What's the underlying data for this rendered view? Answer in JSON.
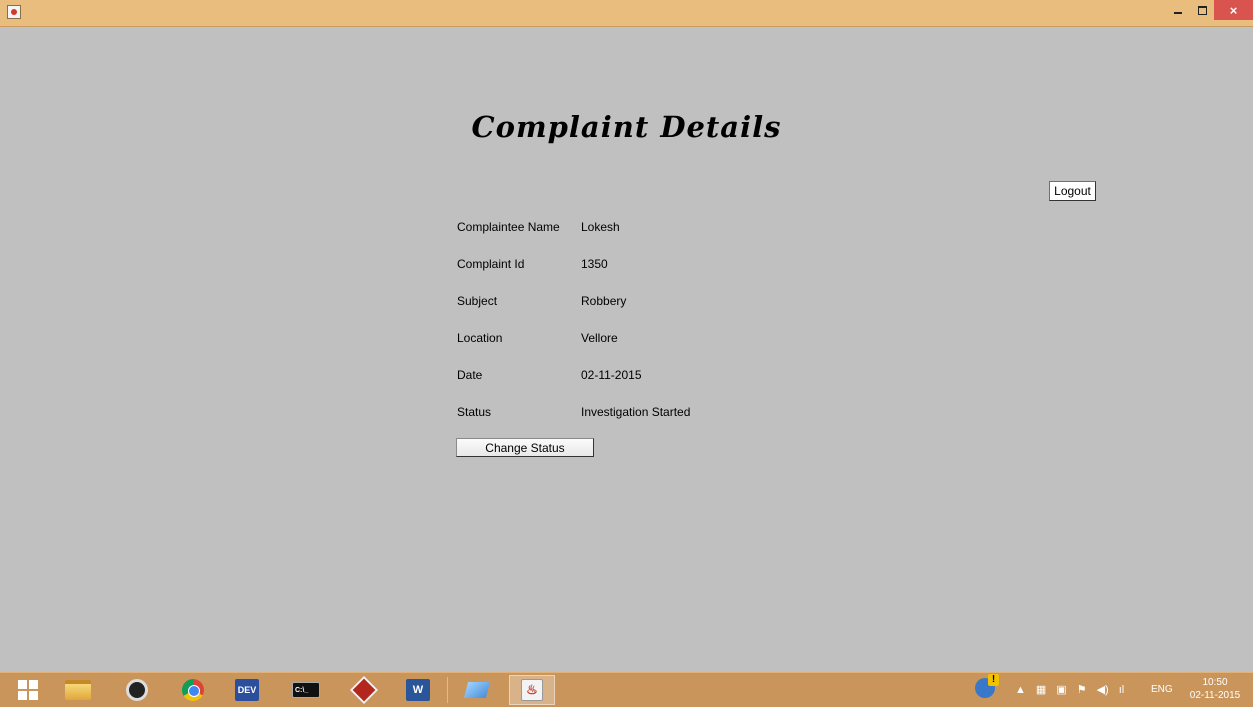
{
  "window": {
    "title": "",
    "icon": "java-app-icon",
    "minimize_label": "",
    "maximize_label": "",
    "close_label": "×"
  },
  "page": {
    "heading": "Complaint Details",
    "logout_label": "Logout",
    "change_status_label": "Change Status"
  },
  "details": [
    {
      "label": "Complaintee Name",
      "value": "Lokesh"
    },
    {
      "label": "Complaint Id",
      "value": "1350"
    },
    {
      "label": "Subject",
      "value": "Robbery"
    },
    {
      "label": "Location",
      "value": "Vellore"
    },
    {
      "label": "Date",
      "value": "02-11-2015"
    },
    {
      "label": "Status",
      "value": "Investigation Started"
    }
  ],
  "taskbar": {
    "apps": [
      "start-icon",
      "file-explorer-icon",
      "camera-icon",
      "chrome-icon",
      "dev-cpp-icon",
      "cmd-icon",
      "diamond-app-icon",
      "word-icon",
      "glass-app-icon",
      "java-icon"
    ],
    "dev_label": "DEV",
    "cmd_label": "C:\\_",
    "word_label": "W",
    "java_label": "♨",
    "language": "ENG",
    "time": "10:50",
    "date": "02-11-2015"
  },
  "colors": {
    "background": "#c0c0c0",
    "titlebar": "#e8bd7e",
    "taskbar": "#c9955a",
    "close": "#d9534f"
  }
}
